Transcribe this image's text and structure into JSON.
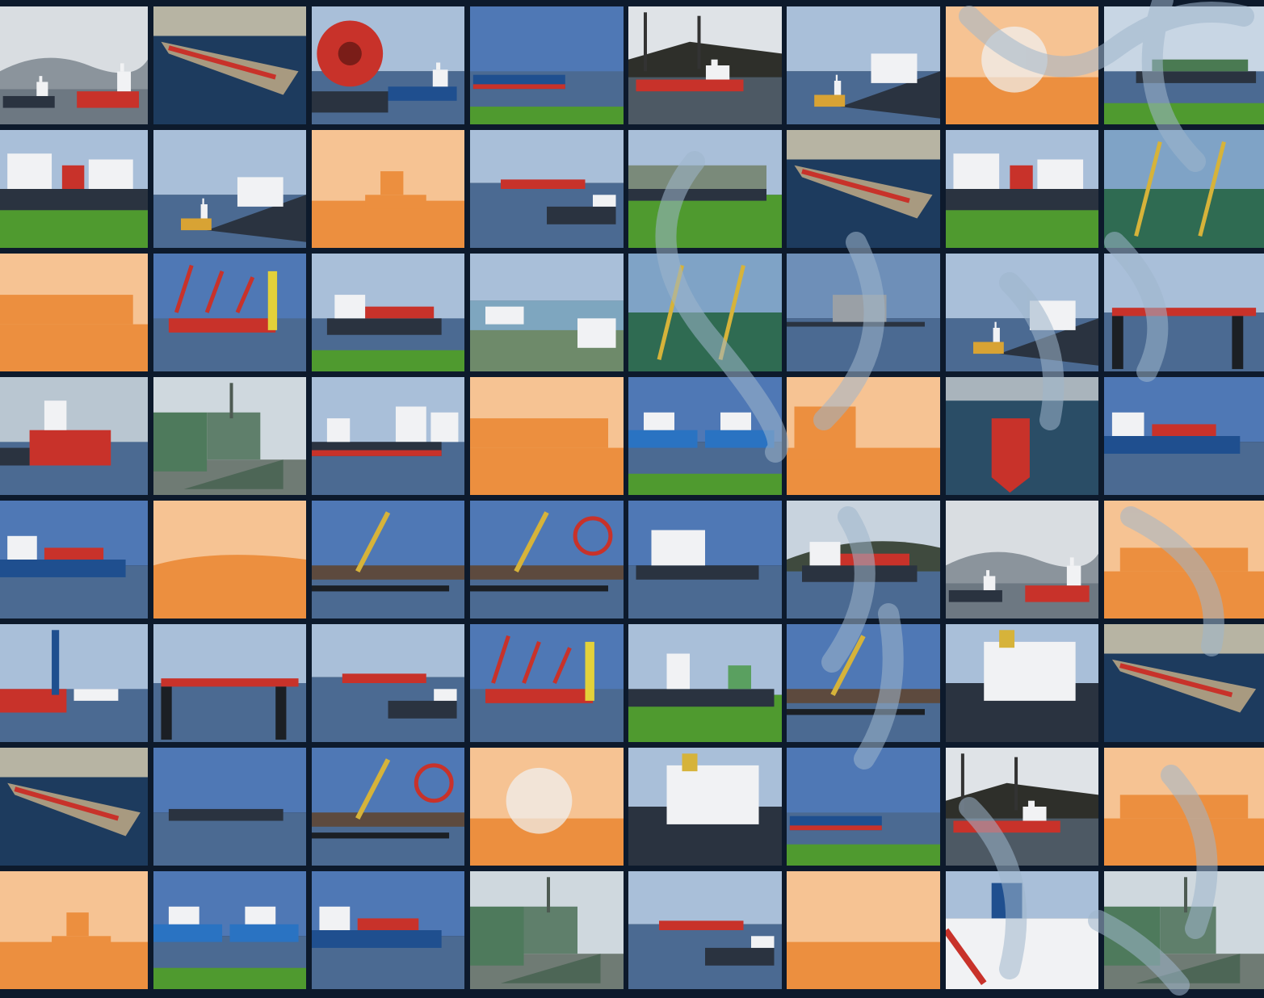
{
  "mosaic": {
    "description_rows": 8,
    "description_cols": 8,
    "colors": {
      "background": "#0d1a2c",
      "sky": "#a9bfd9",
      "sky_deep": "#4f78b5",
      "water": "#4b6a92",
      "water_dark": "#1d3b5e",
      "grass": "#4f9a2f",
      "orange_light": "#f6c393",
      "orange": "#ec8f3f",
      "hull_red": "#c8322a",
      "hull_blue": "#1f4f8f",
      "hull_dark": "#2a3340",
      "white": "#f1f2f4",
      "overlay_swirl": "#9fb6cc"
    },
    "tiles": [
      [
        "snow-ship",
        "aerial-terminal",
        "cable-reel",
        "blue-tanker",
        "tug-dark",
        "icebreaker-tug",
        "orange-reel",
        "container-ship"
      ],
      [
        "tanker-grass",
        "icebreaker-tug",
        "orange-tug",
        "barge-tanker",
        "container-grass",
        "aerial-bulk",
        "tanker-grass",
        "crane-deck"
      ],
      [
        "orange-container",
        "crane-ship",
        "coaster",
        "cruise-terminal",
        "crane-deck",
        "silo",
        "icebreaker-tug",
        "jetty-tanker"
      ],
      [
        "red-tanker",
        "icebreaker",
        "tank-farm",
        "orange-container",
        "blue-ships",
        "orange-superstructure",
        "aerial-red-tanker",
        "tanker-dock"
      ],
      [
        "tanker-dock",
        "orange-snow",
        "crane-quay",
        "reel-quay",
        "white-ship",
        "coaster-dark",
        "snow-ship",
        "orange-deck"
      ],
      [
        "bulk-red",
        "jetty-tanker",
        "barge-tanker",
        "crane-ship",
        "bulk-grass",
        "crane-quay",
        "white-bridge",
        "aerial-bulk"
      ],
      [
        "aerial-terminal",
        "long-tanker",
        "reel-quay",
        "orange-reel",
        "white-bridge",
        "blue-tanker-grass",
        "tug-dark",
        "orange-deck"
      ],
      [
        "orange-tug",
        "blue-ships",
        "tanker-dock",
        "icebreaker",
        "barge-tanker",
        "orange-flat",
        "bridge-closeup",
        "icebreaker"
      ]
    ]
  }
}
